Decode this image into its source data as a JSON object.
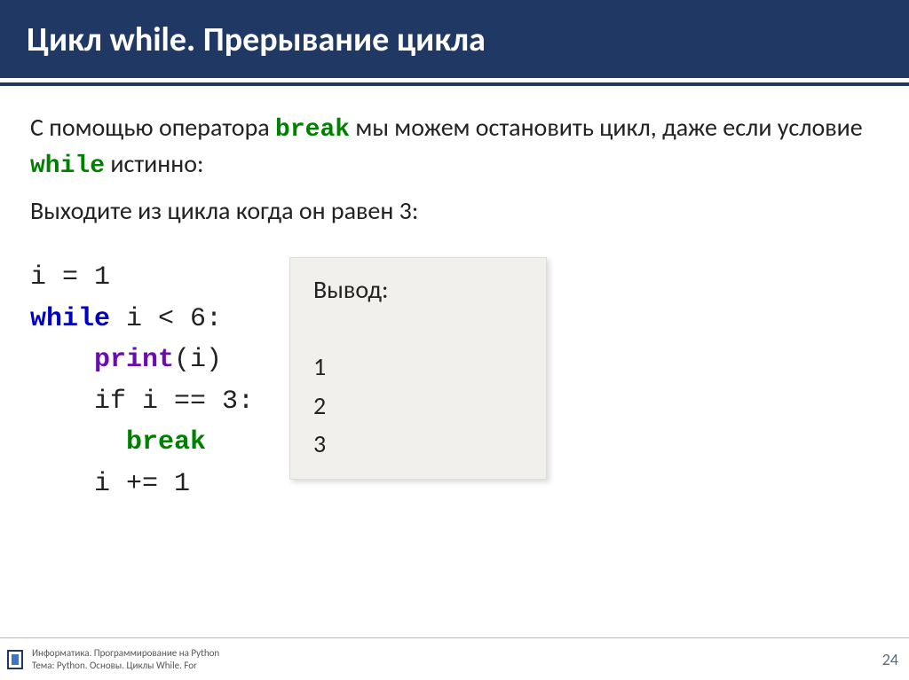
{
  "title": "Цикл while. Прерывание цикла",
  "intro": {
    "p1_a": "С помощью оператора ",
    "kw_break": "break",
    "p1_b": " мы можем остановить цикл, даже если условие ",
    "kw_while": "while",
    "p1_c": " истинно:",
    "p2": "Выходите из цикла когда он равен 3:"
  },
  "code": {
    "l1": "i = 1",
    "l2_kw": "while",
    "l2_rest": " i < 6:",
    "l3_kw": "print",
    "l3_rest": "(i)",
    "l4": "if i == 3:",
    "l5_kw": "break",
    "l6": "i += 1"
  },
  "output": {
    "label": "Вывод:",
    "lines": [
      "1",
      "2",
      "3"
    ]
  },
  "footer": {
    "line1": "Информатика. Программирование на Python",
    "line2": "Тема: Python. Основы. Циклы While. For",
    "page": "24"
  }
}
